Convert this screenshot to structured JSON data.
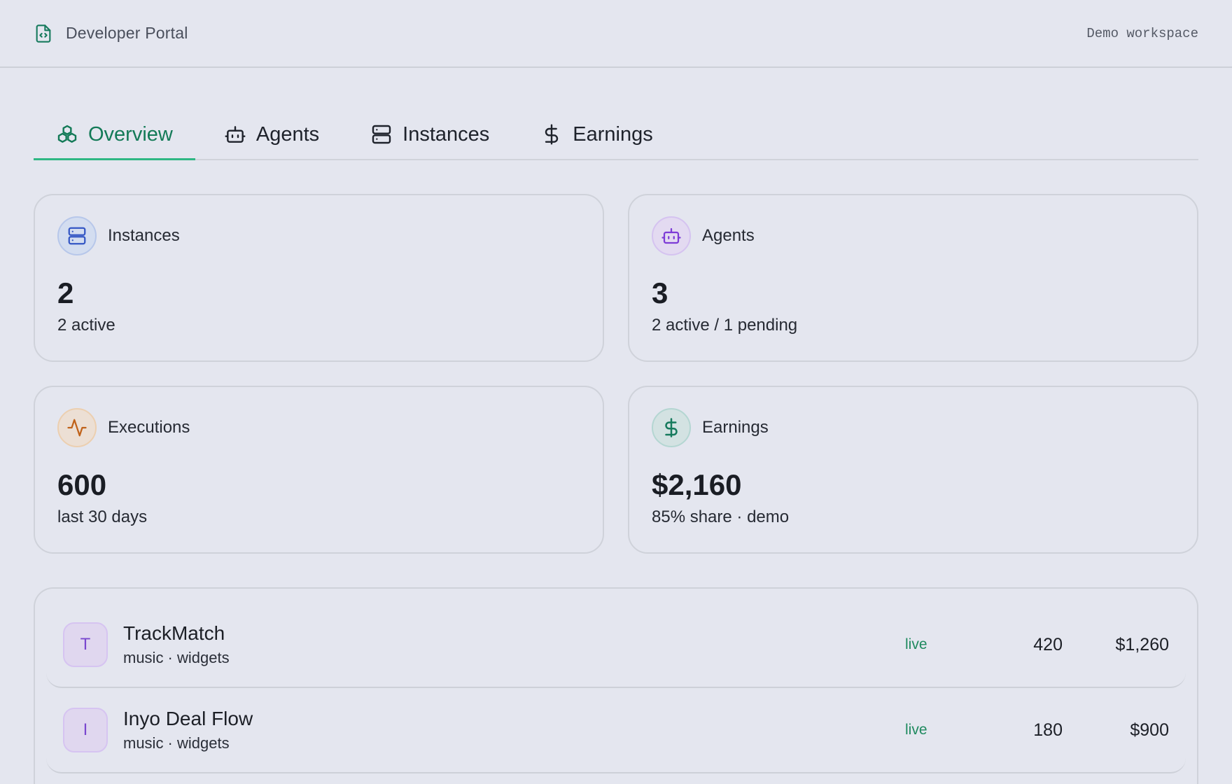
{
  "header": {
    "icon": "file-code-icon",
    "title": "Developer Portal",
    "workspace": "Demo workspace"
  },
  "tabs": [
    {
      "label": "Overview",
      "icon": "boxes-icon",
      "active": true
    },
    {
      "label": "Agents",
      "icon": "robot-icon",
      "active": false
    },
    {
      "label": "Instances",
      "icon": "server-icon",
      "active": false
    },
    {
      "label": "Earnings",
      "icon": "dollar-icon",
      "active": false
    }
  ],
  "stats": [
    {
      "label": "Instances",
      "value": "2",
      "sub": "2 active",
      "icon": "server-icon",
      "color": "#3457c4"
    },
    {
      "label": "Agents",
      "value": "3",
      "sub": "2 active / 1 pending",
      "icon": "robot-icon",
      "color": "#7d3bd6"
    },
    {
      "label": "Executions",
      "value": "600",
      "sub": "last 30 days",
      "icon": "activity-icon",
      "color": "#c0621a"
    },
    {
      "label": "Earnings",
      "value": "$2,160",
      "sub": "85% share · demo",
      "icon": "dollar-icon",
      "color": "#167a5d"
    }
  ],
  "agents": [
    {
      "initial": "T",
      "name": "TrackMatch",
      "tags": "music · widgets",
      "status": "live",
      "executions": "420",
      "earnings": "$1,260"
    },
    {
      "initial": "I",
      "name": "Inyo Deal Flow",
      "tags": "music · widgets",
      "status": "live",
      "executions": "180",
      "earnings": "$900"
    }
  ],
  "colors": {
    "accent": "#137a57",
    "accent_underline": "#2fb784",
    "background": "#e4e6ef"
  }
}
